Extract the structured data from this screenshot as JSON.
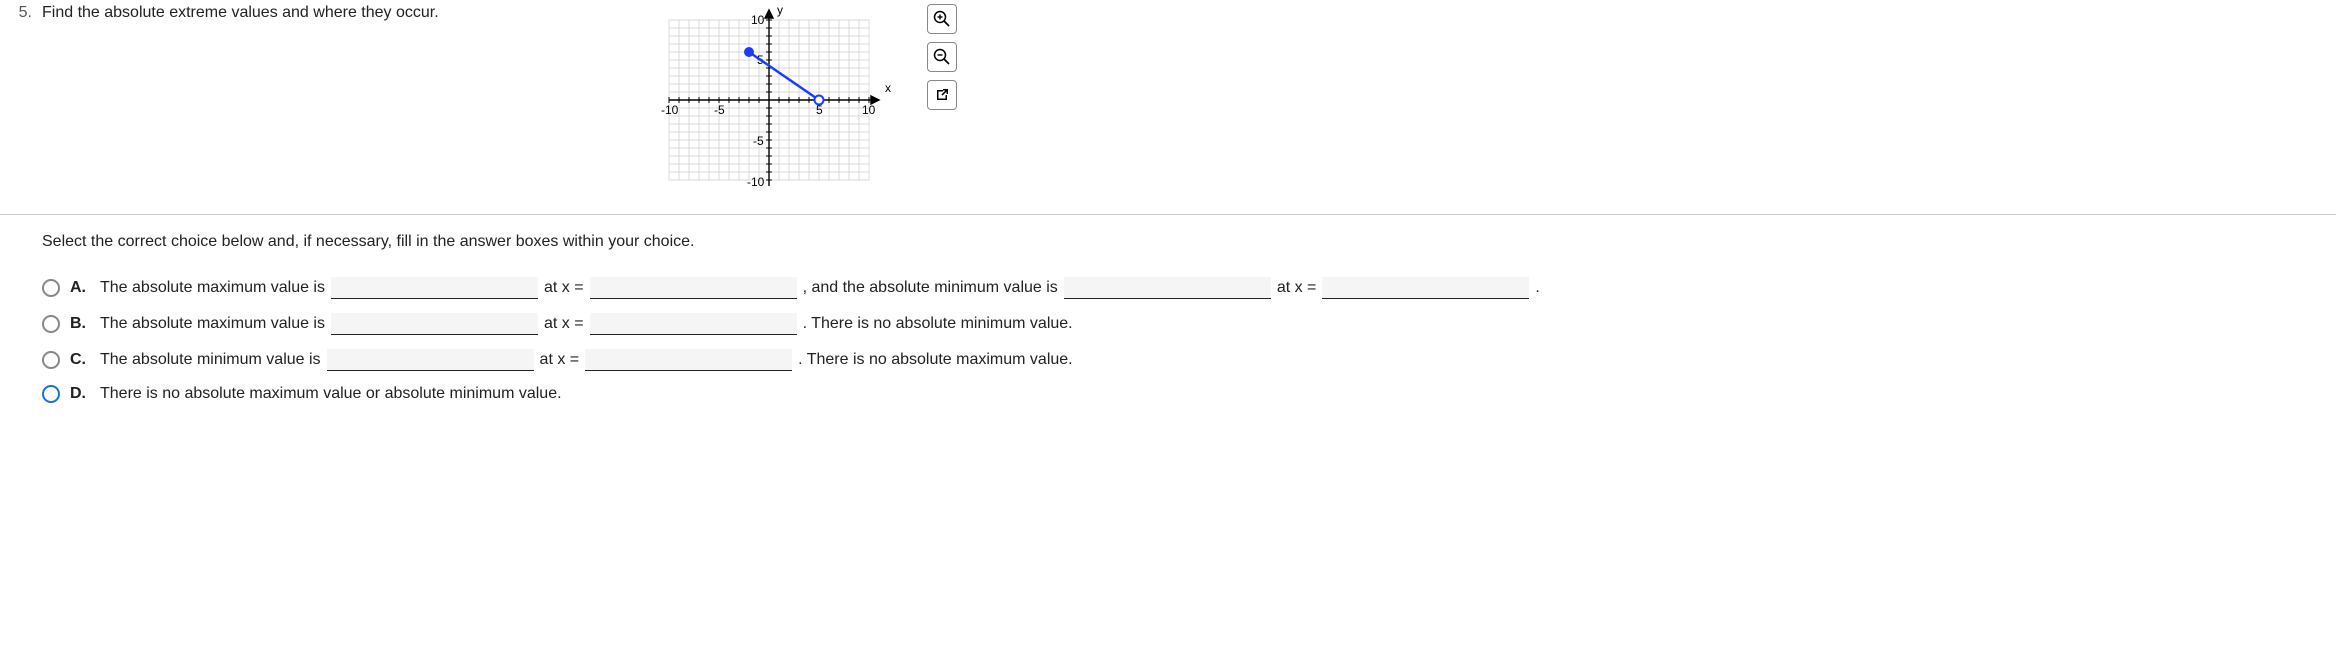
{
  "question": {
    "number": "5.",
    "text": "Find the absolute extreme values and where they occur."
  },
  "instruction": "Select the correct choice below and, if necessary, fill in the answer boxes within your choice.",
  "choices": {
    "A": {
      "label": "A.",
      "seg1": "The absolute maximum value is",
      "seg2": "at x =",
      "seg3": ", and the absolute minimum value is",
      "seg4": "at x =",
      "seg5": "."
    },
    "B": {
      "label": "B.",
      "seg1": "The absolute maximum value is",
      "seg2": "at x =",
      "seg3": ". There is no absolute minimum value."
    },
    "C": {
      "label": "C.",
      "seg1": "The absolute minimum value is",
      "seg2": "at x =",
      "seg3": ". There is no absolute maximum value."
    },
    "D": {
      "label": "D.",
      "seg1": "There is no absolute maximum value or absolute minimum value."
    }
  },
  "chart_data": {
    "type": "line",
    "title": "",
    "xlabel": "x",
    "ylabel": "y",
    "xlim": [
      -10,
      10
    ],
    "ylim": [
      -10,
      10
    ],
    "xticks": [
      -10,
      -5,
      5,
      10
    ],
    "yticks": [
      -10,
      -5,
      5,
      10
    ],
    "series": [
      {
        "name": "segment",
        "x": [
          -2,
          5
        ],
        "y": [
          6,
          0
        ],
        "endpoints": {
          "left": "closed",
          "right": "open"
        },
        "color": "#1a3cff"
      }
    ]
  },
  "tools": {
    "zoom_in": "zoom-in",
    "zoom_out": "zoom-out",
    "open_new": "open-graph"
  }
}
